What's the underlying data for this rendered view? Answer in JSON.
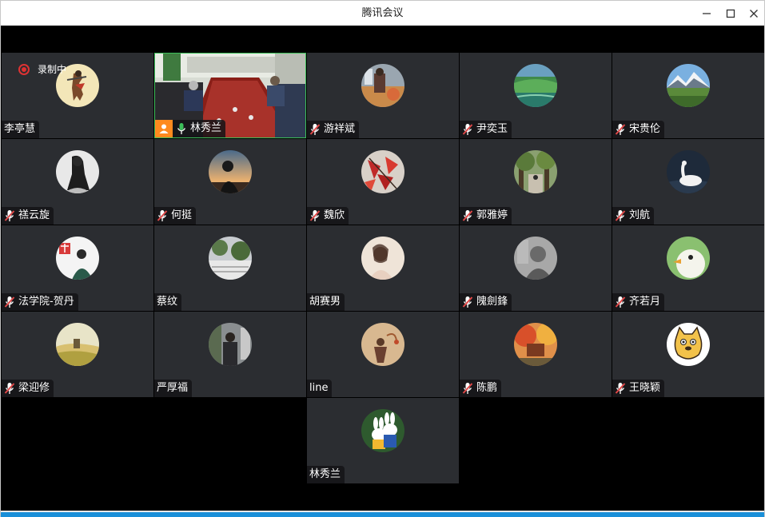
{
  "window": {
    "title": "腾讯会议"
  },
  "recording": {
    "label": "录制中"
  },
  "participants": [
    {
      "name": "李亭慧",
      "mic": false
    },
    {
      "name": "林秀兰",
      "mic": "active",
      "video": true
    },
    {
      "name": "游祥斌",
      "mic": "muted"
    },
    {
      "name": "尹奕玉",
      "mic": "muted"
    },
    {
      "name": "宋贵伦",
      "mic": "muted"
    },
    {
      "name": "禚云旋",
      "mic": "muted"
    },
    {
      "name": "何挺",
      "mic": "muted"
    },
    {
      "name": "魏欣",
      "mic": "muted"
    },
    {
      "name": "郭雅婷",
      "mic": "muted"
    },
    {
      "name": "刘航",
      "mic": "muted"
    },
    {
      "name": "法学院-贺丹",
      "mic": "muted"
    },
    {
      "name": "蔡纹",
      "mic": false
    },
    {
      "name": "胡赛男",
      "mic": false
    },
    {
      "name": "隗劍鋒",
      "mic": "muted"
    },
    {
      "name": "齐若月",
      "mic": "muted"
    },
    {
      "name": "梁迎修",
      "mic": "muted"
    },
    {
      "name": "严厚福",
      "mic": false
    },
    {
      "name": "line",
      "mic": false
    },
    {
      "name": "陈鹏",
      "mic": "muted"
    },
    {
      "name": "王晓颖",
      "mic": "muted"
    },
    {
      "name": "林秀兰",
      "mic": false
    }
  ],
  "colors": {
    "tile_bg": "#2b2d31",
    "mute_red": "#e04848",
    "active_mic": "#3cbf5a",
    "record_red": "#e03030"
  }
}
